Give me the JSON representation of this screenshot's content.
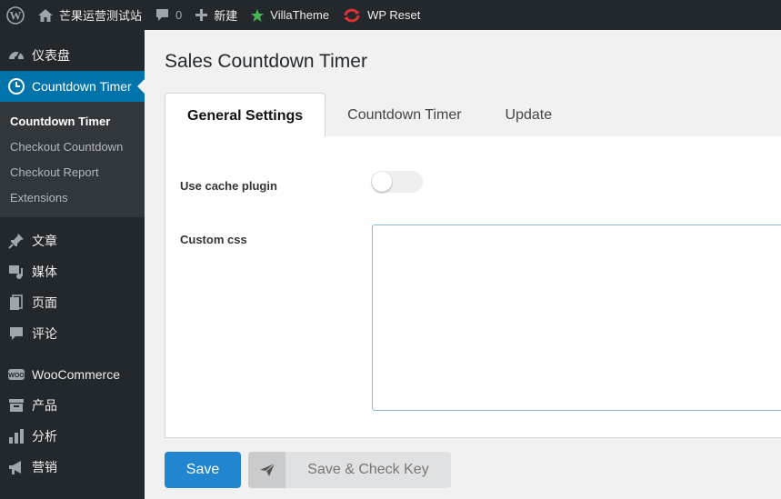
{
  "admin_bar": {
    "site_name": "芒果运营测试站",
    "comments_count": "0",
    "new_label": "新建",
    "villatheme_label": "VillaTheme",
    "wpreset_label": "WP Reset"
  },
  "sidebar": {
    "dashboard": "仪表盘",
    "countdown_timer": "Countdown Timer",
    "submenu": [
      "Countdown Timer",
      "Checkout Countdown",
      "Checkout Report",
      "Extensions"
    ],
    "posts": "文章",
    "media": "媒体",
    "pages": "页面",
    "comments": "评论",
    "woocommerce": "WooCommerce",
    "products": "产品",
    "analytics": "分析",
    "marketing": "营销"
  },
  "page": {
    "title": "Sales Countdown Timer",
    "tabs": [
      "General Settings",
      "Countdown Timer",
      "Update"
    ],
    "use_cache_label": "Use cache plugin",
    "use_cache_enabled": false,
    "custom_css_label": "Custom css",
    "custom_css_value": "",
    "save_label": "Save",
    "save_check_label": "Save & Check Key"
  },
  "colors": {
    "admin_bg": "#23282d",
    "accent": "#0073aa",
    "save_button": "#2185d0"
  }
}
